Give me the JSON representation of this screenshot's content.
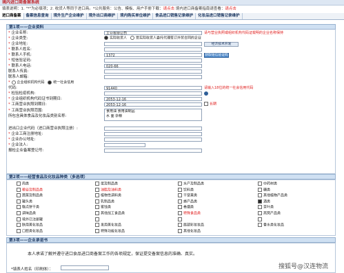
{
  "header": {
    "title": "境内进口商备案系统"
  },
  "notice": {
    "prefix": "填表说明：1. \"*\"为必填项；2. 收货人等同于进口商。*公共服务：公告、模板、用户手册下载：",
    "link1": "请点击",
    "middle": "     境内进口商备案指南请查看：",
    "link2": "请点击"
  },
  "tabs": [
    "进口商备案",
    "备案信息查询",
    "境外生产企业维护",
    "境外出口商维护",
    "境内购买单位维护",
    "食品进口销售记录维护",
    "化妆品进口销售记录维护"
  ],
  "section1": {
    "title": "第1项——企业资料"
  },
  "form": {
    "company_name_label": "企业名称:",
    "company_name_value": "                  工业有限公司",
    "company_name_hint": "请与营业执照或组织机构代码证载明的企业名称保持",
    "company_type_label": "企业类型:",
    "company_type_opt1": "实际收货人",
    "company_type_opt2": "受实际收货人委托代理签订外贸合同的企业",
    "address_label": "企业地址:",
    "address_btn": "经济技术开发",
    "contact_label": "联系人姓名:",
    "contact_value": "",
    "phone_label": "联系人手机:",
    "phone_value": "1372",
    "verify_btn": "获取短信验证码",
    "sms_label": "短信验证码:",
    "tel_label": "联系人电话:",
    "tel_value": "020-66",
    "fax_label": "联系人传真:",
    "email_label": "联系人邮箱:",
    "code_label_opt1": "企业组织机构代码",
    "code_label_opt2": "统一社会信用",
    "code_label_tail": "代码:",
    "code_value": "91440",
    "code_hint": "请输入18位的统一社会信用代码",
    "inspect_label": "检验检疫机构:",
    "org_date_label": "企业组织机构代码证书到期日:",
    "org_date_value": "2053-12-16",
    "license_date_label": "工商营业执照到期日:",
    "license_date_value": "2053-12-16",
    "license_date_btn": "长期",
    "scope_label": "工商营业执照范围:",
    "scope_label2": "所包含具体食品及化妆品类别名称:",
    "scope_value": "食用油  食用油制品",
    "scope_value2": "    水  面  杂粮",
    "tax_label": "进出口企业代码（进口商营业执照注册）:",
    "reg_addr_label": "企业工商注册地址:",
    "office_label": "企业办公地址:",
    "legal_label": "企业法人:",
    "record_no_label": "报检企业备案登记号:"
  },
  "section2": {
    "title": "第2项——经营食品及化妆品种类（多选项）"
  },
  "categories": [
    {
      "label": "肉类",
      "checked": false,
      "red": false
    },
    {
      "label": "蛋及制品类",
      "checked": false,
      "red": false
    },
    {
      "label": "水产及制品类",
      "checked": false,
      "red": false
    },
    {
      "label": "中药材类",
      "checked": false,
      "red": false
    },
    {
      "label": "粮谷及制品类",
      "checked": false,
      "red": true
    },
    {
      "label": "油脂及油料类",
      "checked": false,
      "red": true
    },
    {
      "label": "饮料类",
      "checked": false,
      "red": false
    },
    {
      "label": "糖类",
      "checked": false,
      "red": false
    },
    {
      "label": "蔬菜及制品类",
      "checked": false,
      "red": false
    },
    {
      "label": "植物性调料类",
      "checked": false,
      "red": false
    },
    {
      "label": "干坚果类",
      "checked": false,
      "red": false
    },
    {
      "label": "其他植物产品类",
      "checked": false,
      "red": false
    },
    {
      "label": "罐头类",
      "checked": false,
      "red": false
    },
    {
      "label": "乳制品类",
      "checked": false,
      "red": false
    },
    {
      "label": "蜂产品类",
      "checked": false,
      "red": false
    },
    {
      "label": "酒类",
      "checked": true,
      "red": false
    },
    {
      "label": "糕点饼干类",
      "checked": false,
      "red": false
    },
    {
      "label": "蜜饯类",
      "checked": false,
      "red": false
    },
    {
      "label": "卷烟类",
      "checked": false,
      "red": false
    },
    {
      "label": "茶叶类",
      "checked": false,
      "red": false
    },
    {
      "label": "调味品类",
      "checked": false,
      "red": false
    },
    {
      "label": "其他加工食品类",
      "checked": false,
      "red": false
    },
    {
      "label": "特殊食品类",
      "checked": false,
      "red": true
    },
    {
      "label": "燕窝产品类",
      "checked": false,
      "red": false
    },
    {
      "label": "境外已注册罐",
      "checked": false,
      "red": false
    },
    {
      "label": "",
      "checked": false,
      "red": false
    },
    {
      "label": "",
      "checked": false,
      "red": false
    },
    {
      "label": "",
      "checked": false,
      "red": false
    },
    {
      "label": "肤用美化妆品",
      "checked": false,
      "red": false
    },
    {
      "label": "发用美化妆品",
      "checked": false,
      "red": false
    },
    {
      "label": "唇部彩妆妆品",
      "checked": false,
      "red": false
    },
    {
      "label": "香水类化妆品",
      "checked": false,
      "red": false
    },
    {
      "label": "口腔类化妆品",
      "checked": false,
      "red": false
    },
    {
      "label": "特殊功能化妆品",
      "checked": false,
      "red": false
    },
    {
      "label": "其他化妆品",
      "checked": false,
      "red": false
    }
  ],
  "section3": {
    "title": "第3项——企业承诺书"
  },
  "pledge": {
    "text": "本人承诺了解并遵守进口食品进口商备案工作的各项规定，保证提交备案信息的准确、真实。",
    "sign_label": "*填表人姓名（印刷体）："
  },
  "watermark": "搜狐号@汉连物流"
}
